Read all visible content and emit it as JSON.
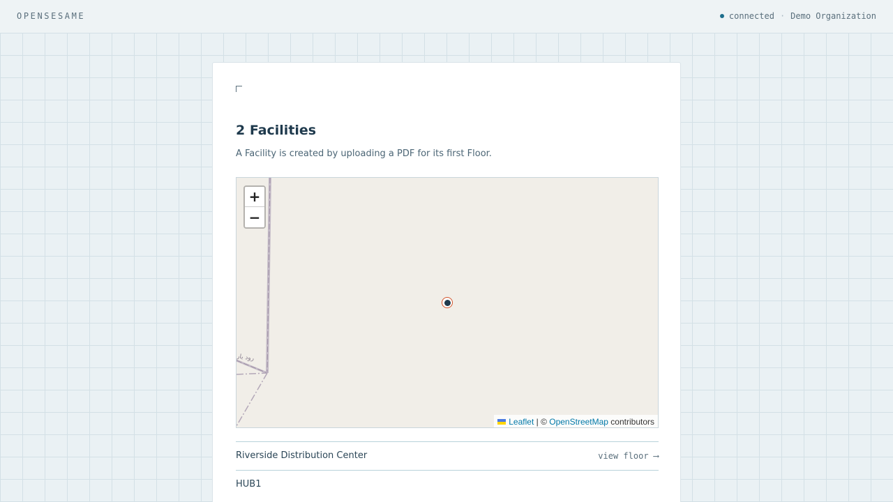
{
  "header": {
    "brand": "OPENSESAME",
    "status": "connected",
    "separator": "·",
    "organization": "Demo Organization"
  },
  "page": {
    "title": "2 Facilities",
    "subtitle": "A Facility is created by uploading a PDF for its first Floor."
  },
  "map": {
    "zoom_in": "+",
    "zoom_out": "−",
    "road_label": "ﺭﻭﺩ ﺑﺎﺭ",
    "attribution": {
      "leaflet": "Leaflet",
      "separator": " | © ",
      "osm": "OpenStreetMap",
      "suffix": " contributors"
    },
    "marker_color": "#d2542b"
  },
  "facilities": [
    {
      "name": "Riverside Distribution Center",
      "action": "view floor ⟶"
    },
    {
      "name": "HUB1",
      "action": ""
    }
  ],
  "colors": {
    "accent": "#1d6e8c",
    "marker": "#d2542b",
    "text": "#1f3a4d"
  }
}
